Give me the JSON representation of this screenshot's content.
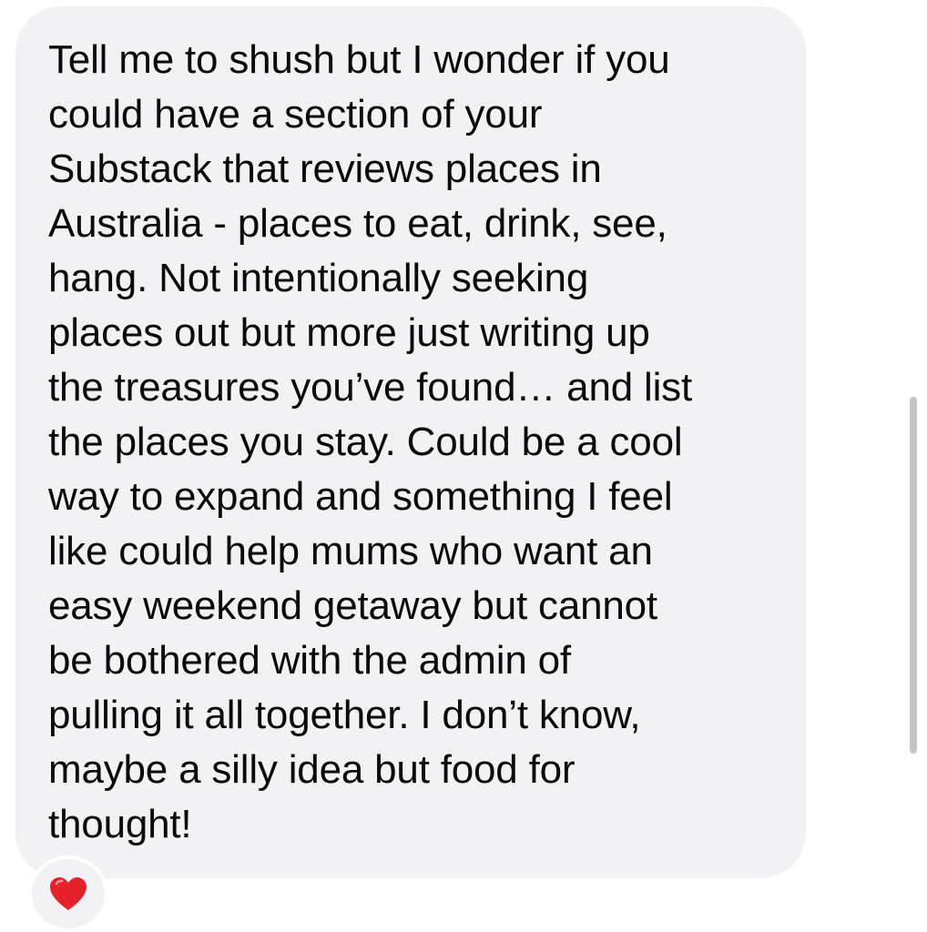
{
  "message": {
    "lines": [
      "Tell me to shush but I wonder if you",
      "could have a section of your",
      "Substack that reviews places in",
      "Australia - places to eat, drink, see,",
      "hang. Not intentionally seeking",
      "places out but more just writing up",
      "the treasures you’ve found… and list",
      "the places you stay. Could be a cool",
      "way to expand and something I feel",
      "like could help mums who want an",
      "easy weekend getaway but cannot",
      "be bothered with the admin of",
      "pulling it all together. I don’t know,",
      "maybe a silly idea but food for",
      "thought!"
    ]
  },
  "reaction": {
    "icon": "red-heart-icon",
    "color": "#e5222c"
  },
  "colors": {
    "bubble": "#f2f2f6",
    "text": "#0b0b0b"
  }
}
